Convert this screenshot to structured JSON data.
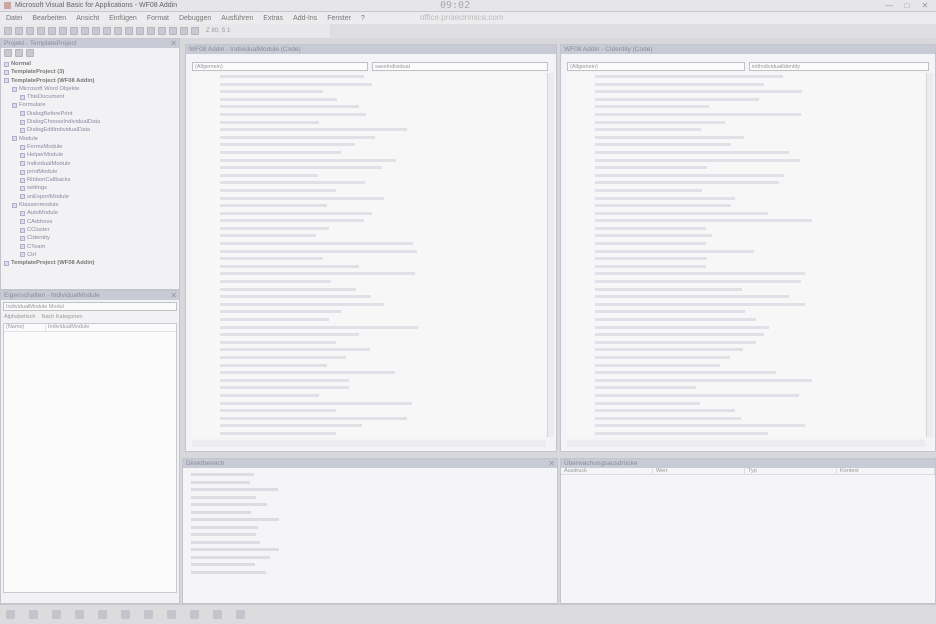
{
  "window": {
    "title": "Microsoft Visual Basic for Applications - WF08 Addin",
    "clock": "09:02",
    "url": "office.proiecinmica.com",
    "controls": [
      "—",
      "□",
      "✕"
    ]
  },
  "menu": [
    "Datei",
    "Bearbeiten",
    "Ansicht",
    "Einfügen",
    "Format",
    "Debuggen",
    "Ausführen",
    "Extras",
    "Add-Ins",
    "Fenster",
    "?"
  ],
  "toolbar": {
    "position": "Z 80, S 1"
  },
  "project": {
    "title": "Projekt - TemplateProject",
    "nodes": [
      {
        "label": "Normal",
        "level": 0,
        "bold": true
      },
      {
        "label": "TemplateProject (3)",
        "level": 0,
        "bold": true
      },
      {
        "label": "TemplateProject (WF08 Addin)",
        "level": 0,
        "bold": true
      },
      {
        "label": "Microsoft Word Objekte",
        "level": 1,
        "bold": false
      },
      {
        "label": "ThisDocument",
        "level": 2,
        "bold": false
      },
      {
        "label": "Formulare",
        "level": 1,
        "bold": false
      },
      {
        "label": "DialogBeforePrint",
        "level": 2,
        "bold": false
      },
      {
        "label": "DialogChooseIndividualData",
        "level": 2,
        "bold": false
      },
      {
        "label": "DialogEditIndividualData",
        "level": 2,
        "bold": false
      },
      {
        "label": "Module",
        "level": 1,
        "bold": false
      },
      {
        "label": "FormsModule",
        "level": 2,
        "bold": false
      },
      {
        "label": "HelperModule",
        "level": 2,
        "bold": false
      },
      {
        "label": "IndividualModule",
        "level": 2,
        "bold": false
      },
      {
        "label": "printModule",
        "level": 2,
        "bold": false
      },
      {
        "label": "RibbonCallbacks",
        "level": 2,
        "bold": false
      },
      {
        "label": "settings",
        "level": 2,
        "bold": false
      },
      {
        "label": "snExportModule",
        "level": 2,
        "bold": false
      },
      {
        "label": "Klassenmodule",
        "level": 1,
        "bold": false
      },
      {
        "label": "AutoModule",
        "level": 2,
        "bold": false
      },
      {
        "label": "CAddress",
        "level": 2,
        "bold": false
      },
      {
        "label": "CCluster",
        "level": 2,
        "bold": false
      },
      {
        "label": "CIdentity",
        "level": 2,
        "bold": false
      },
      {
        "label": "CTeam",
        "level": 2,
        "bold": false
      },
      {
        "label": "Ctrl",
        "level": 2,
        "bold": false
      },
      {
        "label": "TemplateProject (WF08 Addin)",
        "level": 0,
        "bold": true
      }
    ]
  },
  "properties": {
    "title": "Eigenschaften - IndividualModule",
    "selector": "IndividualModule Modul",
    "tabs": [
      "Alphabetisch",
      "Nach Kategorien"
    ],
    "rows": [
      [
        "(Name)",
        "IndividualModule"
      ]
    ]
  },
  "code_left": {
    "title": "WF08 Addin - IndividualModule (Code)",
    "object_combo": "(Allgemein)",
    "proc_combo": "saveIndividual"
  },
  "code_right": {
    "title": "WF08 Addin - CIdentity (Code)",
    "object_combo": "(Allgemein)",
    "proc_combo": "initIndividualIdentity"
  },
  "immediate": {
    "title": "Direktbereich"
  },
  "watch": {
    "title": "Überwachungsausdrücke",
    "columns": [
      "Ausdruck",
      "Wert",
      "Typ",
      "Kontext"
    ]
  },
  "taskbar": {
    "icons": [
      "start-icon",
      "search-icon",
      "taskview-icon",
      "explorer-icon",
      "store-icon",
      "edge-icon",
      "opera-icon",
      "firefox-icon",
      "word-icon",
      "powerpoint-icon",
      "vba-icon"
    ]
  }
}
